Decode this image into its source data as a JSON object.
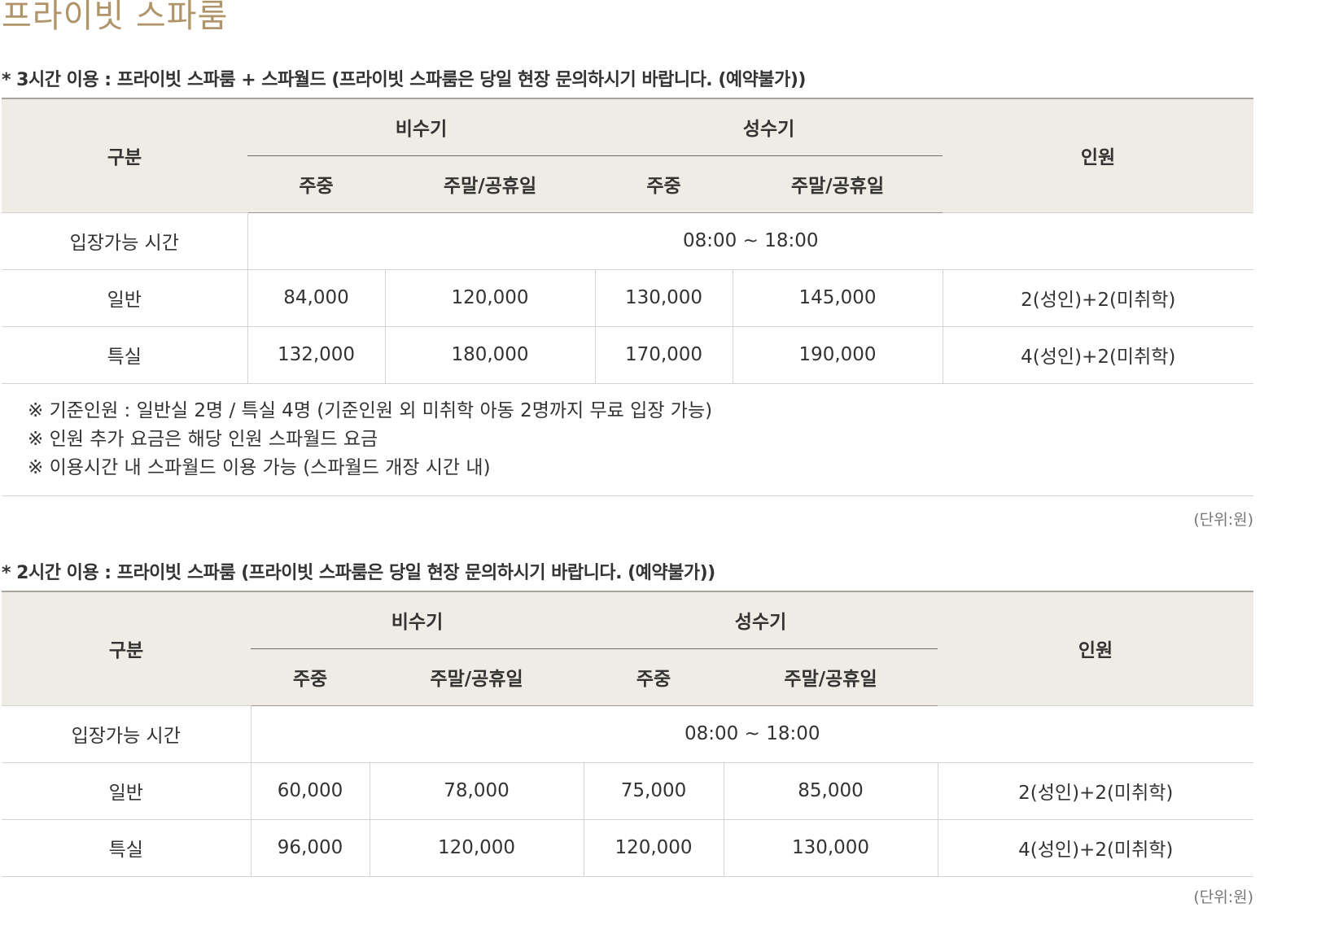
{
  "page_title": "프라이빗 스파룸",
  "sections": [
    {
      "caption": "* 3시간 이용 : 프라이빗 스파룸 + 스파월드 (프라이빗 스파룸은 당일 현장 문의하시기 바랍니다. (예약불가))",
      "header": {
        "category": "구분",
        "off_season": "비수기",
        "peak_season": "성수기",
        "people": "인원",
        "weekday": "주중",
        "weekend": "주말/공휴일"
      },
      "hours_row": {
        "label": "입장가능 시간",
        "value": "08:00 ~ 18:00"
      },
      "rows": [
        {
          "label": "일반",
          "off_weekday": "84,000",
          "off_weekend": "120,000",
          "peak_weekday": "130,000",
          "peak_weekend": "145,000",
          "people": "2(성인)+2(미취학)"
        },
        {
          "label": "특실",
          "off_weekday": "132,000",
          "off_weekend": "180,000",
          "peak_weekday": "170,000",
          "peak_weekend": "190,000",
          "people": "4(성인)+2(미취학)"
        }
      ],
      "notes": [
        "※ 기준인원 : 일반실 2명 / 특실 4명 (기준인원 외 미취학 아동 2명까지 무료 입장 가능)",
        "※ 인원 추가 요금은 해당 인원 스파월드 요금",
        "※ 이용시간 내 스파월드 이용 가능 (스파월드 개장 시간 내)"
      ],
      "unit": "(단위:원)"
    },
    {
      "caption": "* 2시간 이용 : 프라이빗 스파룸 (프라이빗 스파룸은 당일 현장 문의하시기 바랍니다. (예약불가))",
      "header": {
        "category": "구분",
        "off_season": "비수기",
        "peak_season": "성수기",
        "people": "인원",
        "weekday": "주중",
        "weekend": "주말/공휴일"
      },
      "hours_row": {
        "label": "입장가능 시간",
        "value": "08:00 ~ 18:00"
      },
      "rows": [
        {
          "label": "일반",
          "off_weekday": "60,000",
          "off_weekend": "78,000",
          "peak_weekday": "75,000",
          "peak_weekend": "85,000",
          "people": "2(성인)+2(미취학)"
        },
        {
          "label": "특실",
          "off_weekday": "96,000",
          "off_weekend": "120,000",
          "peak_weekday": "120,000",
          "peak_weekend": "130,000",
          "people": "4(성인)+2(미취학)"
        }
      ],
      "unit": "(단위:원)"
    }
  ]
}
